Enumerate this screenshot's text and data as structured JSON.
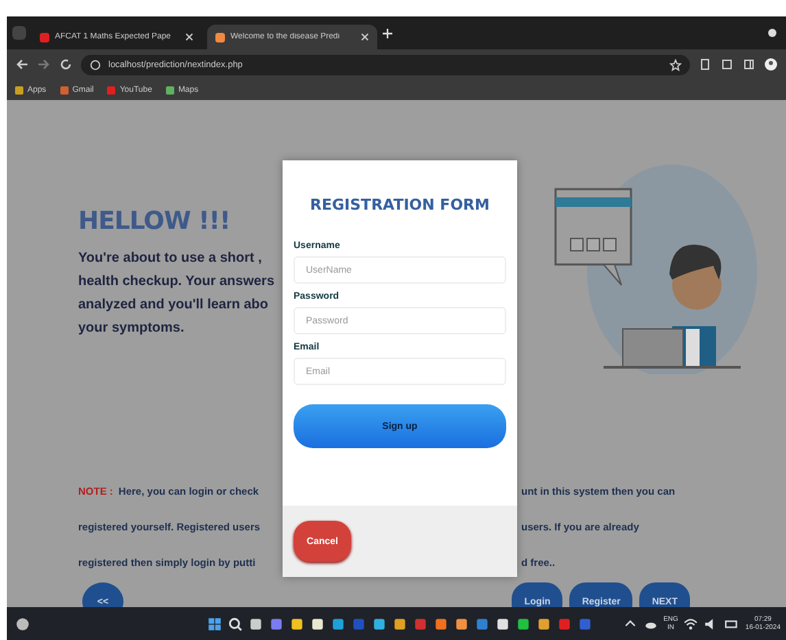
{
  "browser": {
    "tabs": [
      {
        "title": "AFCAT 1 Maths Expected Pape",
        "selected": false
      },
      {
        "title": "Welcome to the disease Predi",
        "selected": true
      }
    ],
    "address": "localhost/prediction/nextindex.php",
    "bookmarks": [
      "Apps",
      "Gmail",
      "YouTube",
      "Maps"
    ]
  },
  "page": {
    "heading": "HELLOW !!!",
    "intro_lines": [
      "You're about to use a short ,",
      "health checkup. Your answers",
      "analyzed and you'll learn abo",
      "your symptoms."
    ],
    "note_label": "NOTE :",
    "note_left": [
      "Here, you can login or check",
      "registered yourself. Registered users",
      "registered then simply login by putti"
    ],
    "note_right": [
      "unt in this system then you can",
      "users. If you are already",
      "d free.."
    ],
    "back_button": "<<",
    "buttons": [
      "Login",
      "Register",
      "NEXT"
    ]
  },
  "modal": {
    "title": "REGISTRATION FORM",
    "fields": [
      {
        "label": "Username",
        "placeholder": "UserName"
      },
      {
        "label": "Password",
        "placeholder": "Password"
      },
      {
        "label": "Email",
        "placeholder": "Email"
      }
    ],
    "submit": "Sign up",
    "cancel": "Cancel"
  },
  "taskbar": {
    "language": "ENG",
    "region": "IN",
    "time": "07:29",
    "date": "16-01-2024"
  }
}
